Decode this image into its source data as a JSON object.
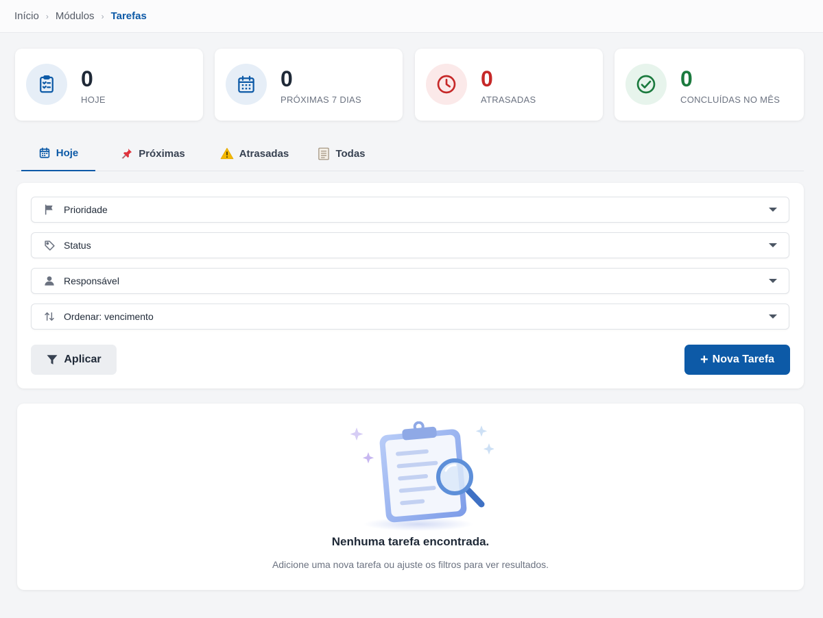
{
  "breadcrumb": {
    "items": [
      "Início",
      "Módulos"
    ],
    "current": "Tarefas"
  },
  "stats": [
    {
      "value": "0",
      "label": "HOJE",
      "icon": "clipboard-check-icon",
      "color": "#0d5aa7",
      "bg": "#e6eef7",
      "value_color": "#1f2937"
    },
    {
      "value": "0",
      "label": "PRÓXIMAS 7 DIAS",
      "icon": "calendar-icon",
      "color": "#0d5aa7",
      "bg": "#e6eef7",
      "value_color": "#1f2937"
    },
    {
      "value": "0",
      "label": "ATRASADAS",
      "icon": "clock-icon",
      "color": "#c62828",
      "bg": "#fbe9e9",
      "value_color": "#c62828"
    },
    {
      "value": "0",
      "label": "CONCLUÍDAS NO MÊS",
      "icon": "check-circle-icon",
      "color": "#1b7a3e",
      "bg": "#e7f4ec",
      "value_color": "#1b7a3e"
    }
  ],
  "tabs": [
    {
      "label": "Hoje",
      "icon": "calendar-icon",
      "active": true
    },
    {
      "label": "Próximas",
      "icon": "pushpin-icon",
      "active": false
    },
    {
      "label": "Atrasadas",
      "icon": "warning-icon",
      "active": false
    },
    {
      "label": "Todas",
      "icon": "document-icon",
      "active": false
    }
  ],
  "filters": {
    "priority": {
      "label": "Prioridade",
      "icon": "flag-icon"
    },
    "status": {
      "label": "Status",
      "icon": "tag-icon"
    },
    "assignee": {
      "label": "Responsável",
      "icon": "user-icon"
    },
    "sort": {
      "label": "Ordenar: vencimento",
      "icon": "sort-arrows-icon"
    }
  },
  "actions": {
    "apply_label": "Aplicar",
    "new_task_label": "Nova Tarefa"
  },
  "empty_state": {
    "title": "Nenhuma tarefa encontrada.",
    "subtitle": "Adicione uma nova tarefa ou ajuste os filtros para ver resultados."
  },
  "colors": {
    "primary": "#0d5aa7",
    "danger": "#c62828",
    "success": "#1b7a3e"
  }
}
